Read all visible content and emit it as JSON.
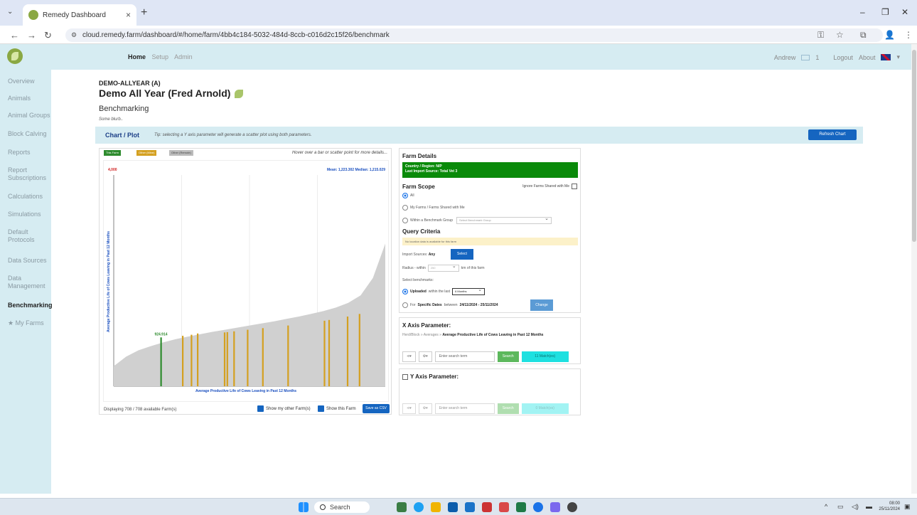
{
  "browser": {
    "tab_title": "Remedy Dashboard",
    "url": "cloud.remedy.farm/dashboard/#/home/farm/4bb4c184-5032-484d-8ccb-c016d2c15f26/benchmark"
  },
  "header": {
    "nav": [
      "Home",
      "Setup",
      "Admin"
    ],
    "user": "Andrew",
    "mail_count": "1",
    "logout": "Logout",
    "about": "About"
  },
  "sidebar": {
    "items": [
      {
        "label": "Overview"
      },
      {
        "label": "Animals"
      },
      {
        "label": "Animal Groups"
      },
      {
        "label": "Block Calving"
      },
      {
        "label": "Reports"
      },
      {
        "label": "Report Subscriptions"
      },
      {
        "label": "Calculations"
      },
      {
        "label": "Simulations"
      },
      {
        "label": "Default Protocols"
      },
      {
        "label": "Data Sources"
      },
      {
        "label": "Data Management"
      },
      {
        "label": "Benchmarking"
      },
      {
        "label": "★ My Farms"
      }
    ]
  },
  "main": {
    "farm_code": "DEMO-ALLYEAR (A)",
    "farm_name": "Demo All Year (Fred Arnold)",
    "page_title": "Benchmarking",
    "page_desc": "Some blurb..",
    "chart_bar": {
      "title": "Chart / Plot",
      "tip": "Tip: selecting a Y axis parameter will generate a scatter plot using both parameters.",
      "refresh": "Refresh Chart"
    }
  },
  "chart_panel": {
    "legend": [
      "This Farm",
      "Other (Mine)",
      "Other (Remote)"
    ],
    "hover_note": "Hover over a bar or scatter point for more details...",
    "displaying": "Displaying 708 / 708 available Farm(s)",
    "show_my_other": "Show my other Farm(s)",
    "show_this": "Show this Farm",
    "save_csv": "Save as CSV"
  },
  "chart_data": {
    "type": "bar",
    "title": "",
    "xlabel": "Average Productive Life of Cows Leaving in Past 12 Months",
    "ylabel": "Average Productive Life of Cows Leaving in Past 12 Months",
    "ymax_label": "4,000",
    "stats_label": "Mean: 1,223.302 Median: 1,215.029",
    "this_farm_label": "924.914",
    "ylim": [
      0,
      4000
    ],
    "farm_count": 708,
    "distribution_profile": [
      380,
      560,
      680,
      760,
      830,
      890,
      940,
      985,
      1030,
      1070,
      1110,
      1150,
      1190,
      1230,
      1275,
      1320,
      1370,
      1425,
      1490,
      1580,
      1720,
      2050,
      2700
    ],
    "this_farm": {
      "rank": 0.174,
      "value": 924.914
    },
    "other_mine": [
      {
        "rank": 0.254,
        "value": 955
      },
      {
        "rank": 0.286,
        "value": 975
      },
      {
        "rank": 0.309,
        "value": 1000
      },
      {
        "rank": 0.408,
        "value": 1020
      },
      {
        "rank": 0.418,
        "value": 1025
      },
      {
        "rank": 0.443,
        "value": 1040
      },
      {
        "rank": 0.493,
        "value": 1070
      },
      {
        "rank": 0.549,
        "value": 1100
      },
      {
        "rank": 0.642,
        "value": 1150
      },
      {
        "rank": 0.776,
        "value": 1240
      },
      {
        "rank": 0.793,
        "value": 1255
      },
      {
        "rank": 0.861,
        "value": 1320
      },
      {
        "rank": 0.905,
        "value": 1370
      }
    ],
    "colors": {
      "all": "#d0d0d0",
      "this_farm": "#2e8b2e",
      "other_mine": "#d4a020",
      "text_blue": "#1a4fbf",
      "text_red": "#d02020"
    }
  },
  "farm_details": {
    "title": "Farm Details",
    "country": "Country / Region: N/P",
    "import_source": "Last Import Source: Total Vet 3",
    "scope_title": "Farm Scope",
    "ignore_shared": "Ignore Farms Shared with Me",
    "scope_all": "All",
    "scope_mine": "My Farms / Farms Shared with Me",
    "scope_group": "Within a Benchmark Group",
    "group_placeholder": "Select Benchmark Group",
    "query_title": "Query Criteria",
    "no_location": "No location data is available for this farm",
    "import_sources": "Import Sources:",
    "import_any": "Any",
    "select": "Select",
    "radius_prefix": "Radius - within",
    "radius_value": "250",
    "radius_suffix": "km of this farm",
    "select_benchmarks": "Select benchmarks:",
    "uploaded": "Uploaded",
    "within_last": "within the last",
    "months": "6 Months",
    "specific_prefix": "For",
    "specific_dates": "Specific Dates",
    "between": "between",
    "date_range": "24/11/2024 - 25/11/2024",
    "change": "Change"
  },
  "x_axis": {
    "title": "X Axis Parameter:",
    "crumb_prefix": "Herd/Block » Averages »",
    "crumb_bold": "Average Productive Life of Cows Leaving in Past 12 Months",
    "search_placeholder": "Enter search term",
    "search": "Search",
    "matches": "11 Match(es)"
  },
  "y_axis": {
    "title": "Y Axis Parameter:",
    "search_placeholder": "Enter search term",
    "search": "Search",
    "matches": "0 Match(es)"
  },
  "taskbar": {
    "search": "Search",
    "time": "08:00",
    "date": "25/11/2024"
  }
}
